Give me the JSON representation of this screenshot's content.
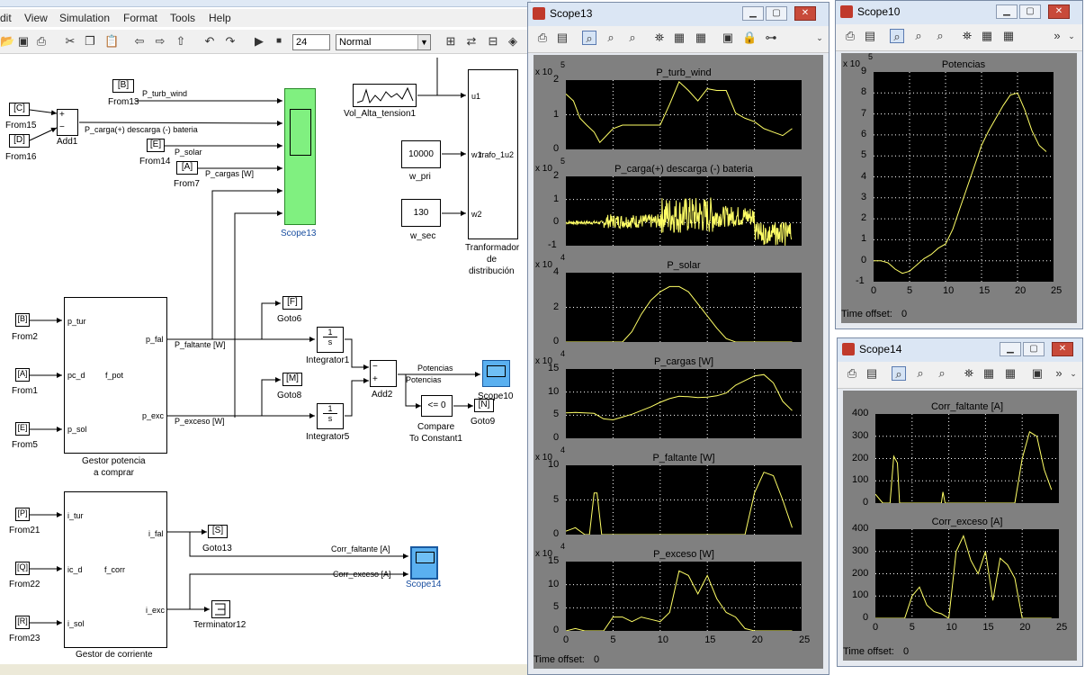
{
  "menu": [
    "dit",
    "View",
    "Simulation",
    "Format",
    "Tools",
    "Help"
  ],
  "toolbar": {
    "stop_time": "24",
    "sim_mode": "Normal"
  },
  "model": {
    "from_blocks": [
      {
        "tag": "[B]",
        "name": "From13",
        "signal": "P_turb_wind"
      },
      {
        "tag": "[C]",
        "name": "From15"
      },
      {
        "tag": "[D]",
        "name": "From16"
      },
      {
        "tag": "[E]",
        "name": "From14",
        "signal": "P_solar"
      },
      {
        "tag": "[A]",
        "name": "From7",
        "signal": "P_cargas [W]"
      },
      {
        "tag": "[B]",
        "name": "From2"
      },
      {
        "tag": "[A]",
        "name": "From1"
      },
      {
        "tag": "[E]",
        "name": "From5"
      },
      {
        "tag": "[P]",
        "name": "From21"
      },
      {
        "tag": "[Q]",
        "name": "From22"
      },
      {
        "tag": "[R]",
        "name": "From23"
      }
    ],
    "add1": "Add1",
    "add1_signal": "P_carga(+) descarga (-) bateria",
    "scope13": "Scope13",
    "vol": "Vol_Alta_tension1",
    "w_pri_val": "10000",
    "w_pri": "w_pri",
    "w_sec_val": "130",
    "w_sec": "w_sec",
    "trafo_port1": "u1",
    "trafo_port2": "w1",
    "trafo_port2b": "trafo_1u2",
    "trafo_port3": "w2",
    "trafo_name": [
      "Tranformador",
      "de",
      "distribución"
    ],
    "gestor_pot": {
      "name": [
        "Gestor potencia",
        "a comprar"
      ],
      "in": [
        "p_tur",
        "pc_d",
        "p_sol"
      ],
      "func": "f_pot",
      "out": [
        "p_fal",
        "p_exc"
      ]
    },
    "goto6": {
      "tag": "[F]",
      "name": "Goto6"
    },
    "goto8": {
      "tag": "[M]",
      "name": "Goto8"
    },
    "integrator1": "Integrator1",
    "integrator5": "Integrator5",
    "int_expr": "1",
    "int_s": "s",
    "sig_faltante": "P_faltante [W]",
    "sig_exceso": "P_exceso [W]",
    "add2": "Add2",
    "add2_minus": "−",
    "add2_plus": "+",
    "potencias": [
      "Potencias",
      "Potencias"
    ],
    "scope10": "Scope10",
    "compare": {
      "expr": "<= 0",
      "name": [
        "Compare",
        "To Constant1"
      ]
    },
    "goto9": {
      "tag": "[N]",
      "name": "Goto9"
    },
    "gestor_corr": {
      "name": "Gestor de corriente",
      "in": [
        "i_tur",
        "ic_d",
        "i_sol"
      ],
      "func": "f_corr",
      "out": [
        "i_fal",
        "i_exc"
      ]
    },
    "goto13": {
      "tag": "[S]",
      "name": "Goto13"
    },
    "sig_corr_fal": "Corr_faltante [A]",
    "sig_corr_exc": "Corr_exceso [A]",
    "scope14": "Scope14",
    "terminator": "Terminator12"
  },
  "scope13": {
    "title": "Scope13",
    "time_offset_label": "Time offset:",
    "time_offset": "0",
    "xticks": [
      "0",
      "5",
      "10",
      "15",
      "20",
      "25"
    ],
    "plots": [
      {
        "title": "P_turb_wind",
        "exp": "5",
        "yticks": [
          "2",
          "1",
          "0"
        ],
        "x": [
          0,
          0.8,
          1.5,
          2.2,
          3,
          3.6,
          4.3,
          5,
          6,
          7,
          8,
          9,
          10,
          11,
          12,
          13,
          14,
          15,
          16,
          17,
          18,
          19,
          20,
          21,
          22,
          23,
          24
        ],
        "y": [
          1.6,
          1.4,
          0.9,
          0.7,
          0.5,
          0.2,
          0.4,
          0.6,
          0.7,
          0.7,
          0.7,
          0.7,
          0.7,
          1.3,
          1.95,
          1.7,
          1.4,
          1.75,
          1.7,
          1.7,
          1.05,
          0.9,
          0.8,
          0.6,
          0.5,
          0.4,
          0.6
        ],
        "ymin": 0,
        "ymax": 2
      },
      {
        "title": "P_carga(+) descarga (-) bateria",
        "exp": "5",
        "yticks": [
          "2",
          "1",
          "0",
          "-1"
        ],
        "ymin": -1,
        "ymax": 2,
        "noise": "battery"
      },
      {
        "title": "P_solar",
        "exp": "4",
        "yticks": [
          "4",
          "2",
          "0"
        ],
        "x": [
          0,
          6,
          7,
          8,
          9,
          10,
          11,
          12,
          13,
          14,
          15,
          16,
          17,
          18,
          24
        ],
        "y": [
          0,
          0,
          0.6,
          1.6,
          2.4,
          2.9,
          3.2,
          3.2,
          2.9,
          2.2,
          1.5,
          0.8,
          0.2,
          0,
          0
        ],
        "ymin": 0,
        "ymax": 4
      },
      {
        "title": "P_cargas [W]",
        "exp": "4",
        "yticks": [
          "15",
          "10",
          "5",
          "0"
        ],
        "x": [
          0,
          1,
          2,
          3,
          4,
          5,
          6,
          7,
          8,
          9,
          10,
          11,
          12,
          13,
          14,
          15,
          16,
          17,
          18,
          19,
          20,
          21,
          22,
          23,
          24
        ],
        "y": [
          5.5,
          5.6,
          5.5,
          5.4,
          4.2,
          4.0,
          4.6,
          5.2,
          6,
          6.8,
          7.8,
          8.6,
          9.1,
          9,
          8.8,
          8.9,
          9.2,
          9.8,
          11.5,
          12.5,
          13.5,
          13.8,
          12,
          8,
          6
        ],
        "ymin": 0,
        "ymax": 15
      },
      {
        "title": "P_faltante [W]",
        "exp": "4",
        "yticks": [
          "10",
          "5",
          "0"
        ],
        "x": [
          0,
          1,
          2,
          2.5,
          3,
          3.3,
          3.8,
          4,
          19,
          20,
          21,
          22,
          23,
          24
        ],
        "y": [
          0.5,
          1,
          0,
          0,
          6,
          6,
          0,
          0,
          0,
          6,
          9,
          8.5,
          5,
          1
        ],
        "ymin": 0,
        "ymax": 10
      },
      {
        "title": "P_exceso [W]",
        "exp": "4",
        "yticks": [
          "15",
          "10",
          "5",
          "0"
        ],
        "x": [
          0,
          1,
          2,
          4,
          5,
          6,
          7,
          8,
          9,
          10,
          11,
          12,
          13,
          14,
          15,
          16,
          17,
          18,
          19,
          20,
          24
        ],
        "y": [
          0,
          0.5,
          0,
          0,
          3,
          3,
          2,
          3,
          2.5,
          2,
          4,
          13,
          12,
          8,
          12,
          7,
          4,
          3,
          0.5,
          0,
          0
        ],
        "ymin": 0,
        "ymax": 15
      }
    ]
  },
  "scope10": {
    "title": "Scope10",
    "time_offset_label": "Time offset:",
    "time_offset": "0",
    "plot_title": "Potencias",
    "exp": "5",
    "yticks": [
      "9",
      "8",
      "7",
      "6",
      "5",
      "4",
      "3",
      "2",
      "1",
      "0",
      "-1"
    ],
    "xticks": [
      "0",
      "5",
      "10",
      "15",
      "20",
      "25"
    ],
    "x": [
      0,
      1,
      2,
      3,
      4,
      5,
      6,
      7,
      8,
      9,
      10,
      11,
      12,
      13,
      14,
      15,
      16,
      17,
      18,
      19,
      20,
      21,
      22,
      23,
      24
    ],
    "y": [
      0,
      0,
      -0.1,
      -0.4,
      -0.6,
      -0.5,
      -0.2,
      0.1,
      0.3,
      0.6,
      0.8,
      1.5,
      2.5,
      3.5,
      4.5,
      5.5,
      6.2,
      6.8,
      7.4,
      7.9,
      8,
      7.2,
      6.2,
      5.5,
      5.2
    ],
    "ymin": -1,
    "ymax": 9
  },
  "scope14": {
    "title": "Scope14",
    "time_offset_label": "Time offset:",
    "time_offset": "0",
    "xticks": [
      "0",
      "5",
      "10",
      "15",
      "20",
      "25"
    ],
    "plots": [
      {
        "title": "Corr_faltante [A]",
        "yticks": [
          "400",
          "300",
          "200",
          "100",
          "0"
        ],
        "x": [
          0,
          1,
          2,
          2.5,
          3,
          3.3,
          4,
          5,
          9,
          9.2,
          9.5,
          10,
          19,
          20,
          21,
          22,
          23,
          24
        ],
        "y": [
          40,
          0,
          0,
          210,
          180,
          0,
          0,
          0,
          0,
          50,
          0,
          0,
          0,
          200,
          320,
          300,
          150,
          60
        ],
        "ymin": 0,
        "ymax": 400
      },
      {
        "title": "Corr_exceso [A]",
        "yticks": [
          "400",
          "300",
          "200",
          "100",
          "0"
        ],
        "x": [
          0,
          2,
          4,
          5,
          6,
          7,
          8,
          9,
          10,
          11,
          12,
          13,
          14,
          15,
          16,
          17,
          18,
          19,
          20,
          24
        ],
        "y": [
          0,
          0,
          0,
          100,
          140,
          60,
          30,
          20,
          0,
          300,
          370,
          260,
          200,
          300,
          80,
          270,
          240,
          180,
          0,
          0
        ],
        "ymin": 0,
        "ymax": 400
      }
    ]
  },
  "colors": {
    "trace": "#ffff66",
    "axes_bg": "#000000",
    "grid": "#ffffff",
    "scope_panel": "#808080",
    "scope_block": "#80f080",
    "scope_block_blue": "#5ab0f0"
  }
}
